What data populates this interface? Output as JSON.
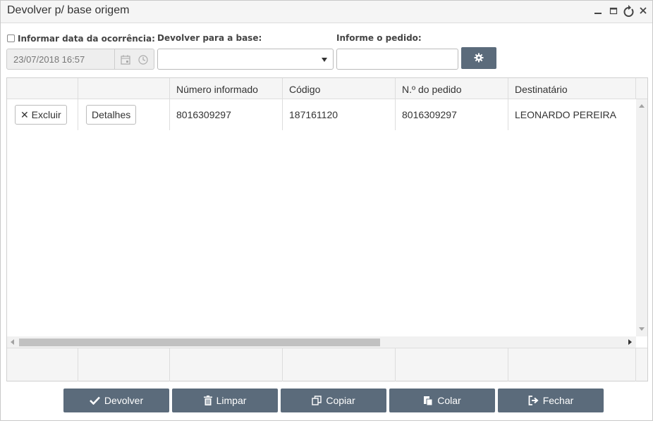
{
  "dialog": {
    "title": "Devolver p/ base origem",
    "controls": [
      "minimize-icon",
      "maximize-icon",
      "refresh-icon",
      "close-icon"
    ]
  },
  "form": {
    "date_checkbox_label": "Informar data da ocorrência:",
    "date_value": "23/07/2018 16:57",
    "base_label": "Devolver para a base:",
    "base_selected": "",
    "order_label": "Informe o pedido:",
    "order_value": "",
    "settings_icon": "gear-icon"
  },
  "grid": {
    "columns": [
      "",
      "",
      "Número informado",
      "Código",
      "N.º do pedido",
      "Destinatário"
    ],
    "rows": [
      {
        "delete_label": "Excluir",
        "details_label": "Detalhes",
        "numero_informado": "8016309297",
        "codigo": "187161120",
        "numero_pedido": "8016309297",
        "destinatario": "LEONARDO PEREIRA"
      }
    ]
  },
  "actions": {
    "devolver": "Devolver",
    "limpar": "Limpar",
    "copiar": "Copiar",
    "colar": "Colar",
    "fechar": "Fechar"
  },
  "colors": {
    "button_bg": "#5b6b7b",
    "header_bg": "#f5f5f5"
  }
}
